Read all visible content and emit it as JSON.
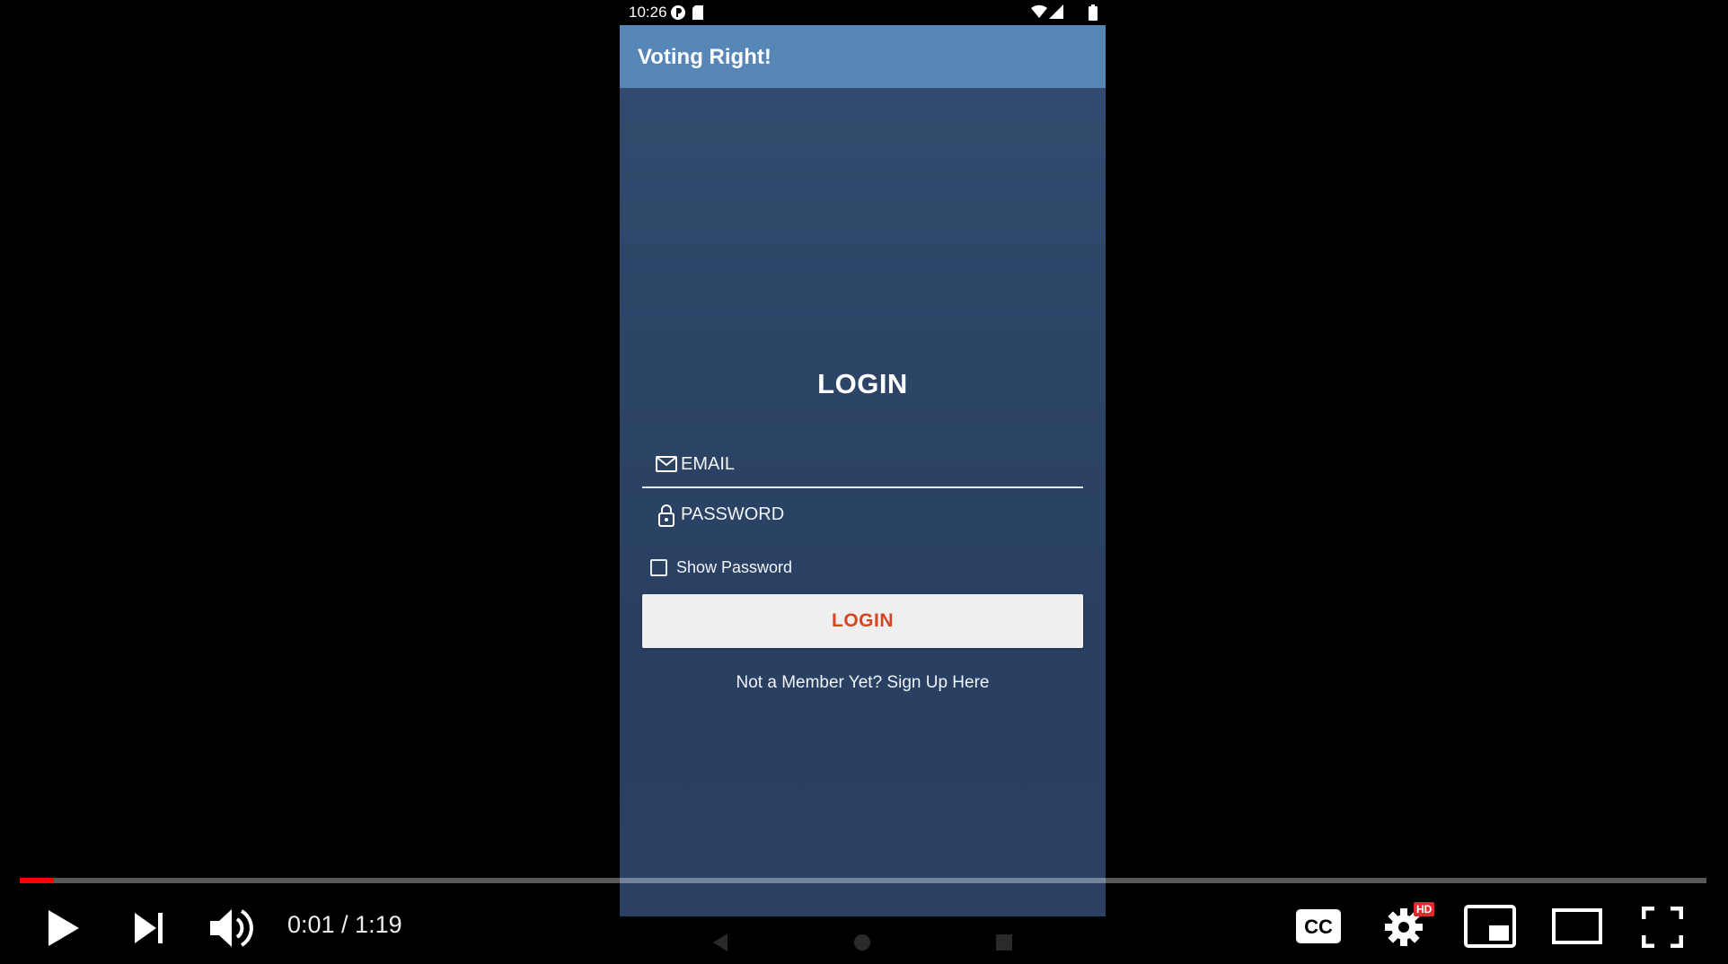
{
  "phone": {
    "status_bar": {
      "time": "10:26"
    },
    "app_bar": {
      "title": "Voting Right!"
    },
    "login": {
      "heading": "LOGIN",
      "email_placeholder": "EMAIL",
      "password_placeholder": "PASSWORD",
      "show_password_label": "Show Password",
      "show_password_checked": false,
      "button_label": "LOGIN",
      "signup_link": "Not a Member Yet? Sign Up Here"
    },
    "colors": {
      "app_bar": "#5686b6",
      "background": "#2c4466",
      "button_text": "#d24722"
    },
    "nav_icons": [
      "back-icon",
      "home-icon",
      "recents-icon"
    ]
  },
  "video_player": {
    "time": "0:01 / 1:19",
    "progress_fraction": 0.02,
    "settings_badge": "HD",
    "icons": [
      "play-icon",
      "next-icon",
      "volume-icon",
      "captions-icon",
      "settings-icon",
      "miniplayer-icon",
      "theater-mode-icon",
      "fullscreen-icon"
    ],
    "colors": {
      "progress": "#ff0000",
      "badge": "#e12a2a"
    }
  }
}
